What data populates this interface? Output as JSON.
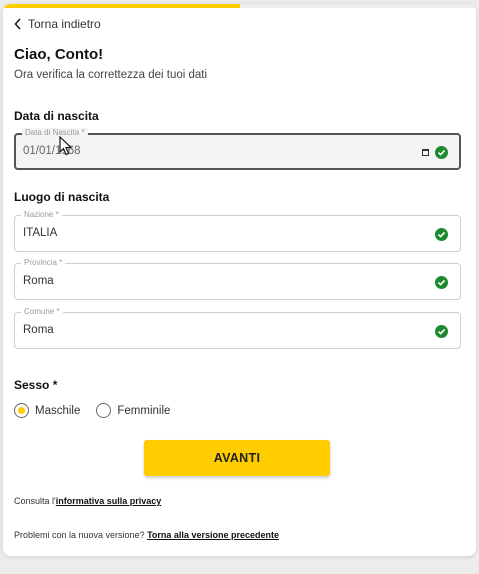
{
  "progress": {
    "fraction": 0.5
  },
  "nav": {
    "back_label": "Torna indietro"
  },
  "header": {
    "title": "Ciao, Conto!",
    "subtitle": "Ora verifica la correttezza dei tuoi dati"
  },
  "birth_date": {
    "section_label": "Data di nascita",
    "field_label": "Data di Nascita *",
    "value": "01/01/1968"
  },
  "birth_place": {
    "section_label": "Luogo di nascita",
    "nazione": {
      "label": "Nazione *",
      "value": "ITALIA"
    },
    "provincia": {
      "label": "Provincia *",
      "value": "Roma"
    },
    "comune": {
      "label": "Comune *",
      "value": "Roma"
    }
  },
  "gender": {
    "section_label": "Sesso *",
    "options": [
      {
        "label": "Maschile",
        "checked": true
      },
      {
        "label": "Femminile",
        "checked": false
      }
    ]
  },
  "actions": {
    "next_label": "AVANTI"
  },
  "footer": {
    "privacy_prefix": "Consulta l'",
    "privacy_link": "informativa sulla privacy",
    "version_prefix": "Problemi con la nuova versione?",
    "version_link": "Torna alla versione precedente"
  },
  "colors": {
    "accent": "#ffcc00",
    "valid": "#1e8a2e"
  },
  "icons": {
    "back": "chevron-left-icon",
    "valid": "check-circle-icon",
    "calendar": "calendar-icon"
  }
}
